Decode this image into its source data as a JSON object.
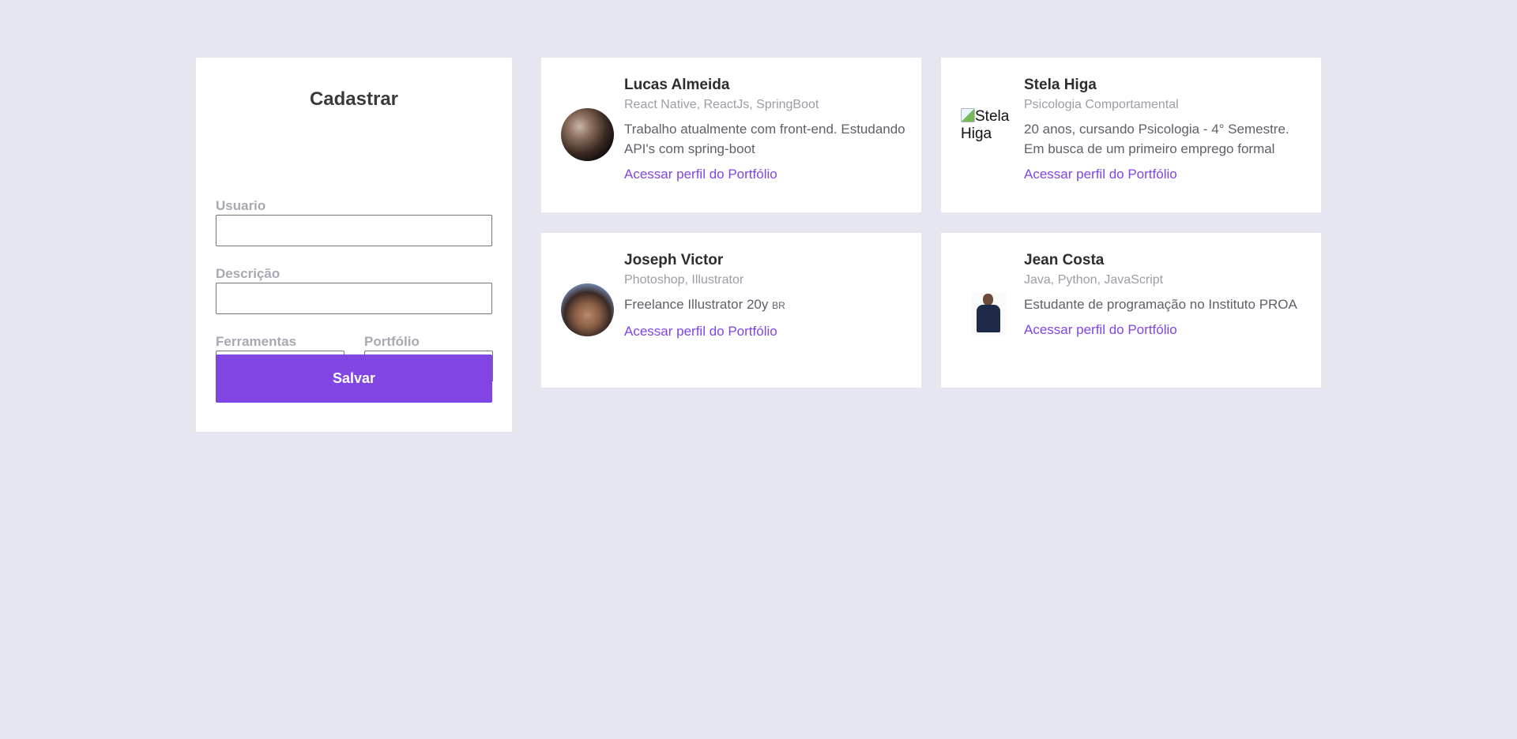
{
  "form": {
    "title": "Cadastrar",
    "usuario_label": "Usuario",
    "usuario_value": "",
    "descricao_label": "Descrição",
    "descricao_value": "",
    "ferramentas_label": "Ferramentas",
    "ferramentas_value": "",
    "portfolio_label": "Portfólio",
    "portfolio_value": "",
    "save_label": "Salvar"
  },
  "cards": [
    {
      "name": "Lucas Almeida",
      "tools": "React Native, ReactJs, SpringBoot",
      "description": "Trabalho atualmente com front-end. Estudando API's com spring-boot",
      "link": "Acessar perfil do Portfólio",
      "avatar": "photo-avatar"
    },
    {
      "name": "Stela Higa",
      "tools": "Psicologia Comportamental",
      "description": "20 anos, cursando Psicologia - 4° Semestre. Em busca de um primeiro emprego formal",
      "link": "Acessar perfil do Portfólio",
      "avatar": "broken-image-icon",
      "avatar_alt": "Stela Higa"
    },
    {
      "name": "Joseph Victor",
      "tools": "Photoshop, Illustrator",
      "description": "Freelance Illustrator 20y",
      "badge": "BR",
      "link": "Acessar perfil do Portfólio",
      "avatar": "photo-avatar"
    },
    {
      "name": "Jean Costa",
      "tools": "Java, Python, JavaScript",
      "description": "Estudante de programação no Instituto PROA",
      "link": "Acessar perfil do Portfólio",
      "avatar": "photo-avatar"
    }
  ],
  "colors": {
    "background": "#e5e6f0",
    "accent": "#8045e3",
    "label": "#a8a8b3"
  }
}
